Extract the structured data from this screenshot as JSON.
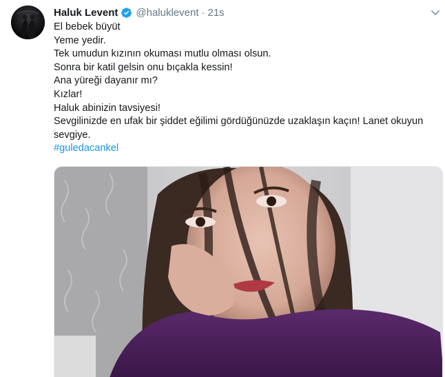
{
  "tweet": {
    "author_name": "Haluk Levent",
    "handle": "@haluklevent",
    "separator": "·",
    "time": "21s",
    "verified_icon": "verified-badge-icon",
    "menu_icon": "chevron-down-icon",
    "lines": [
      "El bebek büyüt",
      "Yeme yedir.",
      "Tek umudun kızının okuması mutlu olması olsun.",
      "Sonra bir katil gelsin onu bıçakla kessin!",
      "Ana yüreği dayanır mı?",
      "Kızlar!",
      "Haluk abinizin tavsiyesi!",
      "Sevgilinizde en ufak bir şiddet eğilimi gördüğünüzde uzaklaşın kaçın! Lanet okuyun",
      "sevgiye."
    ],
    "hashtag": "#guledacankel",
    "colors": {
      "link": "#1b95e0",
      "verified": "#1da1f2",
      "secondary_text": "#657786"
    }
  }
}
